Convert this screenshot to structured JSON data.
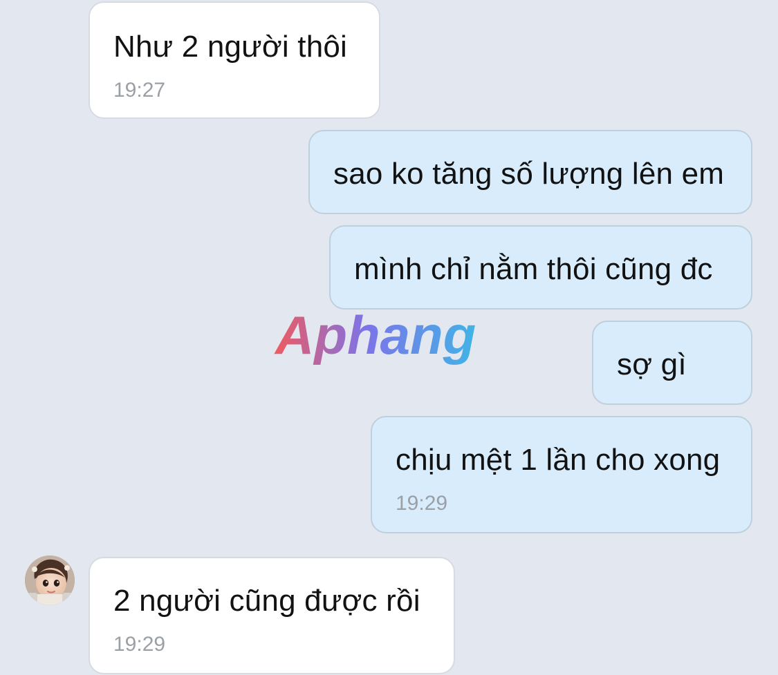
{
  "messages": [
    {
      "direction": "incoming",
      "text": "Như 2 người thôi",
      "time": "19:27"
    },
    {
      "direction": "outgoing",
      "text": "sao ko tăng số lượng lên em"
    },
    {
      "direction": "outgoing",
      "text": "mình chỉ nằm thôi cũng đc"
    },
    {
      "direction": "outgoing",
      "text": "sợ gì"
    },
    {
      "direction": "outgoing",
      "text": "chịu mệt 1 lần cho xong",
      "time": "19:29"
    },
    {
      "direction": "incoming",
      "text": "2 người cũng được rồi",
      "time": "19:29"
    }
  ],
  "watermark": {
    "text": "Aphang"
  },
  "colors": {
    "background": "#e3e7ef",
    "incoming_bubble": "#ffffff",
    "outgoing_bubble": "#d8ecfb",
    "timestamp": "#9aa0a6"
  },
  "icons": {
    "avatar": "baby-girl-avatar-icon"
  }
}
